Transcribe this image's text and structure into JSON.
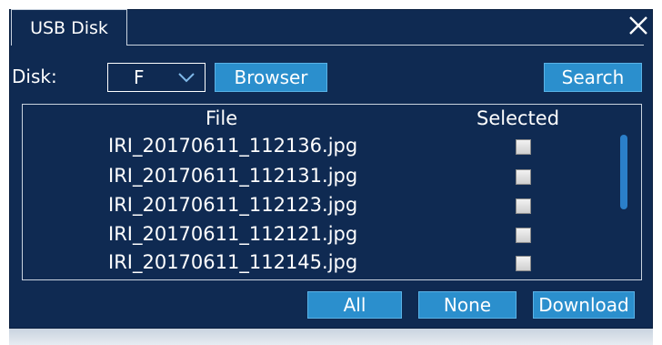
{
  "window": {
    "tab_label": "USB Disk",
    "close_icon": "close-icon"
  },
  "toolbar": {
    "disk_label": "Disk:",
    "disk_value": "F",
    "browser_label": "Browser",
    "search_label": "Search"
  },
  "file_list": {
    "col_file": "File",
    "col_selected": "Selected",
    "rows": [
      {
        "name": "IRI_20170611_112136.jpg",
        "selected": false
      },
      {
        "name": "IRI_20170611_112131.jpg",
        "selected": false
      },
      {
        "name": "IRI_20170611_112123.jpg",
        "selected": false
      },
      {
        "name": "IRI_20170611_112121.jpg",
        "selected": false
      },
      {
        "name": "IRI_20170611_112145.jpg",
        "selected": false
      }
    ]
  },
  "footer": {
    "all_label": "All",
    "none_label": "None",
    "download_label": "Download"
  },
  "colors": {
    "panel": "#0f2a52",
    "button": "#2b8fcd",
    "scrollbar": "#2b7fc9"
  }
}
